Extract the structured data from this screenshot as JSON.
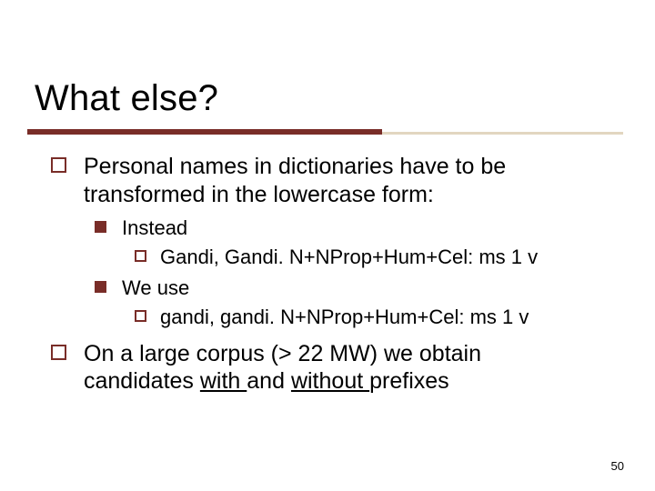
{
  "slide": {
    "title": "What else?",
    "page_number": "50",
    "accent_color": "#792d28"
  },
  "bullets": {
    "p1_a": "Personal names in dictionaries have to be",
    "p1_b": "transformed in the lowercase form:",
    "instead": "Instead",
    "ex1": "Gandi, Gandi. N+NProp+Hum+Cel: ms 1 v",
    "weuse": "We use",
    "ex2": "gandi, gandi. N+NProp+Hum+Cel: ms 1 v",
    "p2_a": "On a large corpus (> 22 MW) we obtain",
    "p2_b": "candidates ",
    "p2_with": "with ",
    "p2_and": "and ",
    "p2_without": "without ",
    "p2_c": "prefixes"
  }
}
